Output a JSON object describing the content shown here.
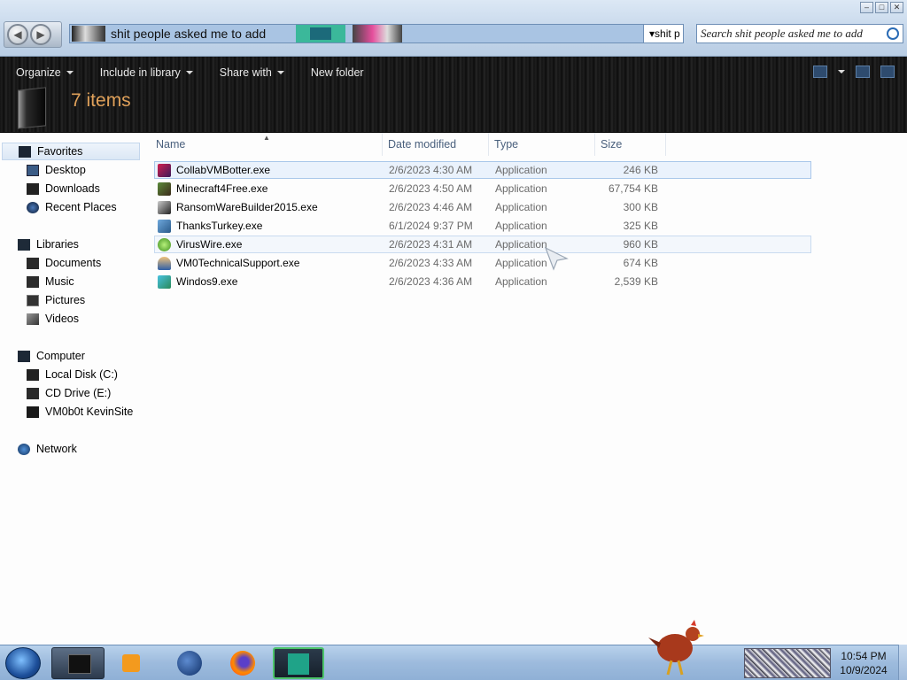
{
  "window": {
    "address_text": "shit people asked me to add",
    "address_dropdown": "shit p",
    "search_placeholder": "Search shit people asked me to add",
    "controls": {
      "minimize": "–",
      "maximize": "□",
      "close": "✕"
    }
  },
  "toolbar": {
    "organize": "Organize",
    "include_in_library": "Include in library",
    "share_with": "Share with",
    "new_folder": "New folder",
    "item_count": "7 items"
  },
  "sidebar": {
    "favorites": "Favorites",
    "desktop": "Desktop",
    "downloads": "Downloads",
    "recent_places": "Recent Places",
    "libraries": "Libraries",
    "documents": "Documents",
    "music": "Music",
    "pictures": "Pictures",
    "videos": "Videos",
    "computer": "Computer",
    "local_disk": "Local Disk (C:)",
    "cd_drive": "CD Drive (E:)",
    "kevinsite": "VM0b0t KevinSite",
    "network": "Network"
  },
  "columns": {
    "name": "Name",
    "date": "Date modified",
    "type": "Type",
    "size": "Size"
  },
  "files": [
    {
      "name": "CollabVMBotter.exe",
      "date": "2/6/2023 4:30 AM",
      "type": "Application",
      "size": "246 KB"
    },
    {
      "name": "Minecraft4Free.exe",
      "date": "2/6/2023 4:50 AM",
      "type": "Application",
      "size": "67,754 KB"
    },
    {
      "name": "RansomWareBuilder2015.exe",
      "date": "2/6/2023 4:46 AM",
      "type": "Application",
      "size": "300 KB"
    },
    {
      "name": "ThanksTurkey.exe",
      "date": "6/1/2024 9:37 PM",
      "type": "Application",
      "size": "325 KB"
    },
    {
      "name": "VirusWire.exe",
      "date": "2/6/2023 4:31 AM",
      "type": "Application",
      "size": "960 KB"
    },
    {
      "name": "VM0TechnicalSupport.exe",
      "date": "2/6/2023 4:33 AM",
      "type": "Application",
      "size": "674 KB"
    },
    {
      "name": "Windos9.exe",
      "date": "2/6/2023 4:36 AM",
      "type": "Application",
      "size": "2,539 KB"
    }
  ],
  "clock": {
    "time": "10:54 PM",
    "date": "10/9/2024"
  }
}
